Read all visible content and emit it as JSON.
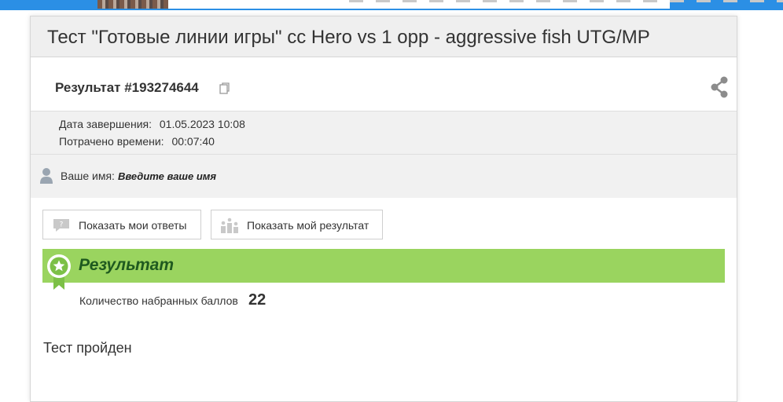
{
  "header": {
    "title": "Тест \"Готовые линии игры\" сс Hero vs 1 opp - aggressive fish UTG/MP"
  },
  "result": {
    "id_label": "Результат #193274644"
  },
  "meta": {
    "completed_label": "Дата завершения:",
    "completed_value": "01.05.2023 10:08",
    "time_label": "Потрачено времени:",
    "time_value": "00:07:40"
  },
  "user": {
    "name_label": "Ваше имя:",
    "name_value": "Введите ваше имя"
  },
  "buttons": {
    "show_answers": "Показать мои ответы",
    "show_result": "Показать мой результат"
  },
  "result_section": {
    "title": "Результат",
    "score_label": "Количество набранных баллов",
    "score_value": "22",
    "status": "Тест пройден"
  },
  "colors": {
    "accent_top": "#2b8fe5",
    "result_bar": "#9ad45f",
    "result_title": "#1f5a1f"
  },
  "icons": [
    "copy-icon",
    "share-icon",
    "user-icon",
    "question-icon",
    "podium-icon",
    "award-ribbon-icon"
  ]
}
